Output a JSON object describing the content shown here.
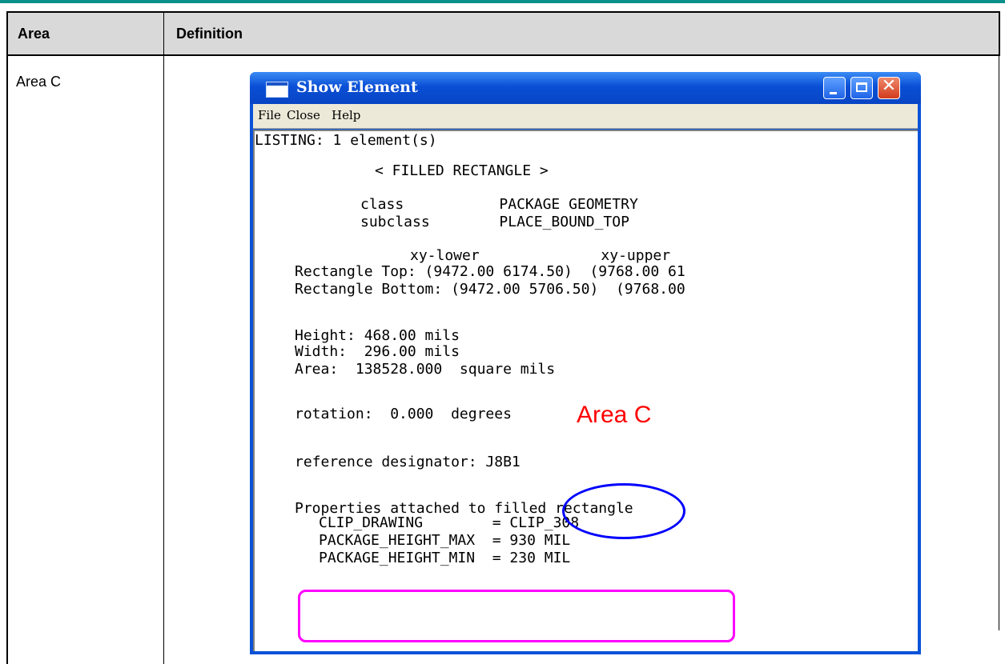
{
  "table": {
    "header_area": "Area",
    "header_definition": "Definition",
    "row_area": "Area C"
  },
  "window": {
    "title": "Show Element",
    "menu": {
      "file": "File",
      "close": "Close",
      "help": "Help"
    },
    "lines": [
      "LISTING: 1 element(s)",
      "< FILLED RECTANGLE >",
      "class           PACKAGE GEOMETRY",
      "subclass        PLACE_BOUND_TOP",
      "xy-lower              xy-upper",
      "Rectangle Top: (9472.00 6174.50)  (9768.00 61",
      "Rectangle Bottom: (9472.00 5706.50)  (9768.00",
      "Height: 468.00 mils",
      "Width:  296.00 mils",
      "Area:  138528.000  square mils",
      "rotation:  0.000  degrees",
      "reference designator: J8B1",
      "Properties attached to filled rectangle",
      "CLIP_DRAWING        = CLIP_308",
      "PACKAGE_HEIGHT_MAX  = 930 MIL",
      "PACKAGE_HEIGHT_MIN  = 230 MIL"
    ]
  },
  "annotation": {
    "label": "Area C",
    "label_color": "#ff0000",
    "circle_color": "#0000ff",
    "box_color": "#ff00ff"
  }
}
